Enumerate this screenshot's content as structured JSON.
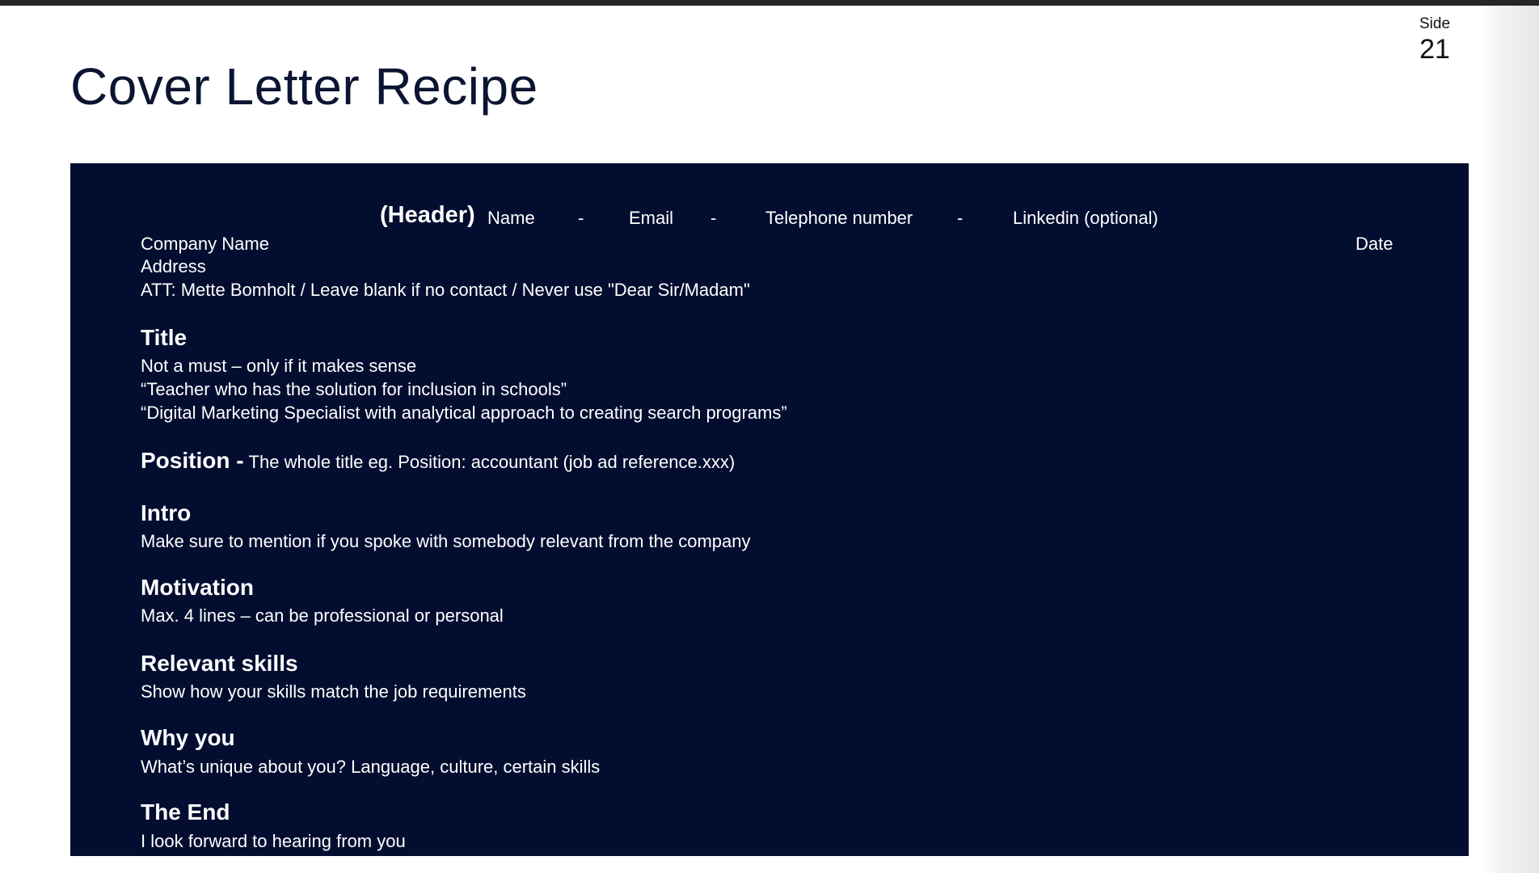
{
  "slide": {
    "label": "Side",
    "number": "21"
  },
  "title": "Cover Letter Recipe",
  "header_row": {
    "label": "(Header)",
    "name": "Name",
    "sep1": "-",
    "email": "Email",
    "sep2": "-",
    "telephone": "Telephone number",
    "sep3": "-",
    "linkedin": "Linkedin (optional)"
  },
  "address_block": {
    "company": "Company Name",
    "date": "Date",
    "address": "Address",
    "att": "ATT:  Mette Bomholt / Leave blank if no contact / Never use \"Dear Sir/Madam\""
  },
  "sections": {
    "title": {
      "heading": "Title",
      "lines": [
        "Not a must – only if it makes sense",
        "“Teacher who has the solution for inclusion in schools”",
        "“Digital Marketing Specialist with analytical approach to creating search programs”"
      ]
    },
    "position": {
      "heading": "Position -",
      "text": "The whole title eg. Position: accountant (job ad reference.xxx)"
    },
    "intro": {
      "heading": "Intro",
      "text": "Make sure to mention if you spoke with somebody relevant from the company"
    },
    "motivation": {
      "heading": "Motivation",
      "text": "Max. 4 lines – can be professional or personal"
    },
    "skills": {
      "heading": "Relevant skills",
      "text": "Show how your skills match the job requirements"
    },
    "why": {
      "heading": "Why you",
      "text": "What’s unique about you?  Language, culture, certain skills"
    },
    "end": {
      "heading": "The End",
      "text": "I look forward to hearing from you"
    }
  }
}
